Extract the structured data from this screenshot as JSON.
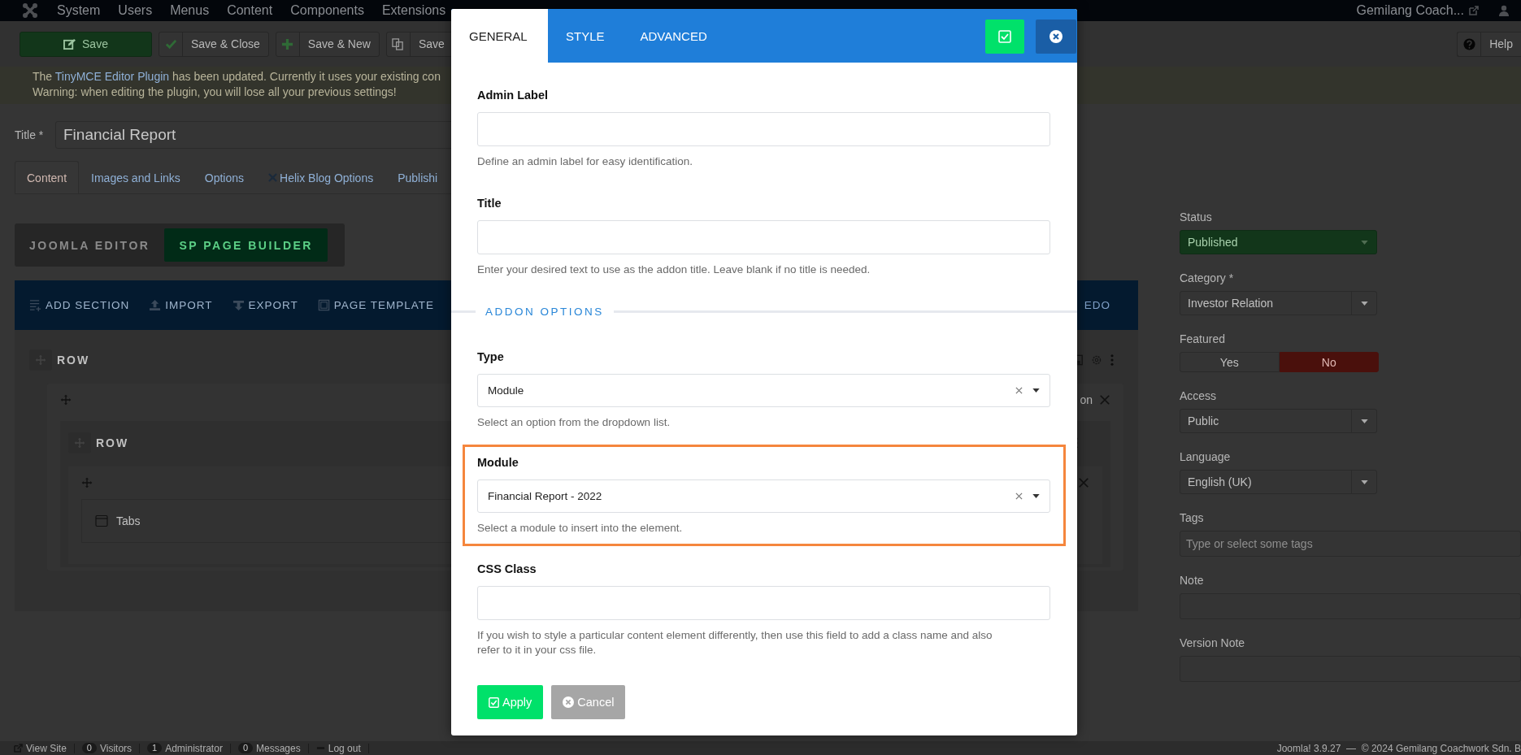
{
  "nav": {
    "menus": [
      "System",
      "Users",
      "Menus",
      "Content",
      "Components",
      "Extensions"
    ],
    "site_link": "Gemilang Coach..."
  },
  "toolbar": {
    "buttons": [
      {
        "label": "Save",
        "kind": "primary"
      },
      {
        "label": "Save & Close",
        "kind": "check"
      },
      {
        "label": "Save & New",
        "kind": "plus"
      },
      {
        "label": "Save",
        "kind": "copy"
      }
    ],
    "help": "Help"
  },
  "alert": {
    "before": "The ",
    "link": "TinyMCE Editor Plugin",
    "after": " has been updated. Currently it uses your existing con",
    "warning": "Warning: when editing the plugin, you will lose all your previous settings!"
  },
  "title_field": {
    "label": "Title *",
    "value": "Financial Report"
  },
  "tabs": [
    {
      "label": "Content",
      "selected": true,
      "kind": "plain"
    },
    {
      "label": "Images and Links",
      "selected": false,
      "kind": "plain"
    },
    {
      "label": "Options",
      "selected": false,
      "kind": "plain"
    },
    {
      "label": "Helix Blog Options",
      "selected": false,
      "kind": "icon"
    },
    {
      "label": "Publishi",
      "selected": false,
      "kind": "plain"
    }
  ],
  "editor_switch": [
    {
      "label": "JOOMLA EDITOR",
      "selected": false
    },
    {
      "label": "SP PAGE BUILDER",
      "selected": true
    }
  ],
  "builder_toolbar": {
    "actions": [
      {
        "label": "ADD SECTION",
        "kind": "add"
      },
      {
        "label": "IMPORT",
        "kind": "import"
      },
      {
        "label": "EXPORT",
        "kind": "export"
      },
      {
        "label": "PAGE TEMPLATE",
        "kind": "template"
      }
    ],
    "right_action": "EDO"
  },
  "builder": {
    "row_label": "ROW",
    "column_text": "on",
    "inner_row_label": "ROW",
    "addon": "Tabs"
  },
  "sidebar": {
    "fields": [
      {
        "label": "Status",
        "kind": "status",
        "value": "Published"
      },
      {
        "label": "Category *",
        "kind": "select",
        "value": "Investor Relation"
      },
      {
        "label": "Featured",
        "kind": "toggle",
        "options": [
          {
            "label": "Yes",
            "selected": false
          },
          {
            "label": "No",
            "selected": true
          }
        ]
      },
      {
        "label": "Access",
        "kind": "select",
        "value": "Public"
      },
      {
        "label": "Language",
        "kind": "select",
        "value": "English (UK)"
      },
      {
        "label": "Tags",
        "kind": "tags",
        "placeholder": "Type or select some tags"
      },
      {
        "label": "Note",
        "kind": "text"
      },
      {
        "label": "Version Note",
        "kind": "text"
      }
    ]
  },
  "status_bar": {
    "items": [
      {
        "label": "View Site",
        "kind": "link"
      },
      {
        "count": "0",
        "label": "Visitors",
        "kind": "count"
      },
      {
        "count": "1",
        "label": "Administrator",
        "kind": "count"
      },
      {
        "count": "0",
        "label": "Messages",
        "kind": "count"
      },
      {
        "label": "Log out",
        "kind": "logout"
      }
    ],
    "version": "Joomla! 3.9.27  —  © 2024 Gemilang Coachwork Sdn. B"
  },
  "modal": {
    "tabs": [
      {
        "label": "GENERAL",
        "selected": true
      },
      {
        "label": "STYLE",
        "selected": false
      },
      {
        "label": "ADVANCED",
        "selected": false
      }
    ],
    "fields": [
      {
        "kind": "text",
        "label": "Admin Label",
        "help": "Define an admin label for easy identification."
      },
      {
        "kind": "text",
        "label": "Title",
        "help": "Enter your desired text to use as the addon title. Leave blank if no title is needed."
      },
      {
        "kind": "divider",
        "label": "ADDON OPTIONS"
      },
      {
        "kind": "select",
        "label": "Type",
        "value": "Module",
        "help": "Select an option from the dropdown list.",
        "highlighted": false
      },
      {
        "kind": "select",
        "label": "Module",
        "value": "Financial Report - 2022",
        "help": "Select a module to insert into the element.",
        "highlighted": true
      },
      {
        "kind": "text",
        "label": "CSS Class",
        "help": "If you wish to style a particular content element differently, then use this field to add a class name and also refer to it in your css file."
      }
    ],
    "buttons": [
      {
        "label": "Apply",
        "kind": "apply"
      },
      {
        "label": "Cancel",
        "kind": "cancel"
      }
    ]
  }
}
